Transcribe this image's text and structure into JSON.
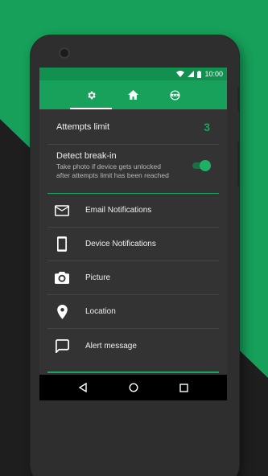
{
  "status_bar": {
    "time": "10:00"
  },
  "tabs": [
    {
      "name": "settings",
      "active": true
    },
    {
      "name": "home",
      "active": false
    },
    {
      "name": "intruder",
      "active": false
    }
  ],
  "settings": {
    "attempts_limit": {
      "label": "Attempts limit",
      "value": "3"
    },
    "detect_break_in": {
      "title": "Detect break-in",
      "subtitle_line1": "Take photo if device gets unlocked",
      "subtitle_line2": "after attempts limit has been reached",
      "enabled": true
    }
  },
  "menu": [
    {
      "icon": "email-icon",
      "label": "Email Notifications"
    },
    {
      "icon": "device-icon",
      "label": "Device Notifications"
    },
    {
      "icon": "camera-icon",
      "label": "Picture"
    },
    {
      "icon": "location-pin-icon",
      "label": "Location"
    },
    {
      "icon": "chat-bubble-icon",
      "label": "Alert message"
    }
  ],
  "colors": {
    "accent": "#19a55e",
    "toolbar": "#17a15b",
    "status_bar": "#12904f",
    "background_green": "#16a05a",
    "surface": "#333333"
  }
}
